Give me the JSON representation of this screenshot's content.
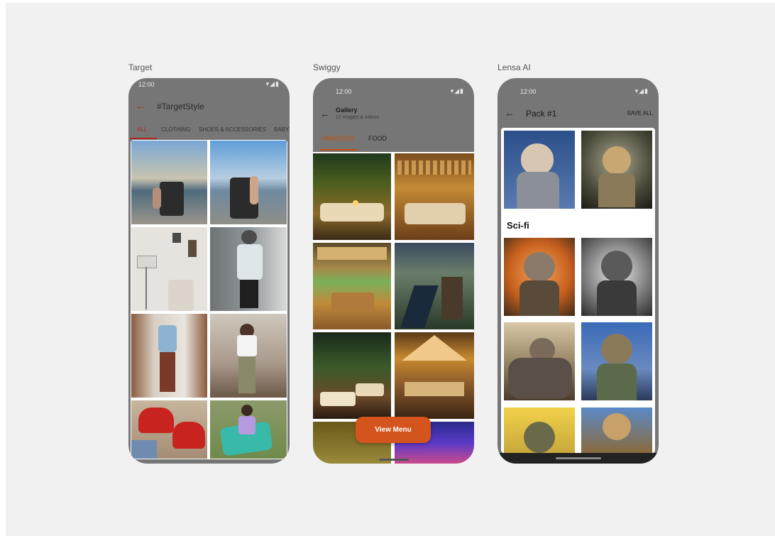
{
  "screens": [
    {
      "label": "Target",
      "status": {
        "time": "12:00",
        "icons": "▾◢▮"
      },
      "title": "#TargetStyle",
      "tabs": [
        "ALL",
        "CLOTHING",
        "SHOES & ACCESSORIES",
        "BABY"
      ],
      "active_tab": "ALL"
    },
    {
      "label": "Swiggy",
      "status": {
        "time": "12:00",
        "icons": "▾◢▮"
      },
      "title": "Gallery",
      "subtitle": "12 images & videos",
      "tabs": [
        "AMBIENCE",
        "FOOD"
      ],
      "active_tab": "AMBIENCE",
      "cta": "View Menu"
    },
    {
      "label": "Lensa AI",
      "status": {
        "time": "12:00",
        "icons": "▾◢▮"
      },
      "title": "Pack #1",
      "action": "SAVE ALL",
      "section": "Sci-fi"
    }
  ],
  "icons": {
    "back": "back-arrow-icon"
  },
  "colors": {
    "target_accent": "#b1241d",
    "swiggy_accent": "#c45311",
    "swiggy_button": "#d4541d",
    "overlay_gray": "#767676"
  }
}
